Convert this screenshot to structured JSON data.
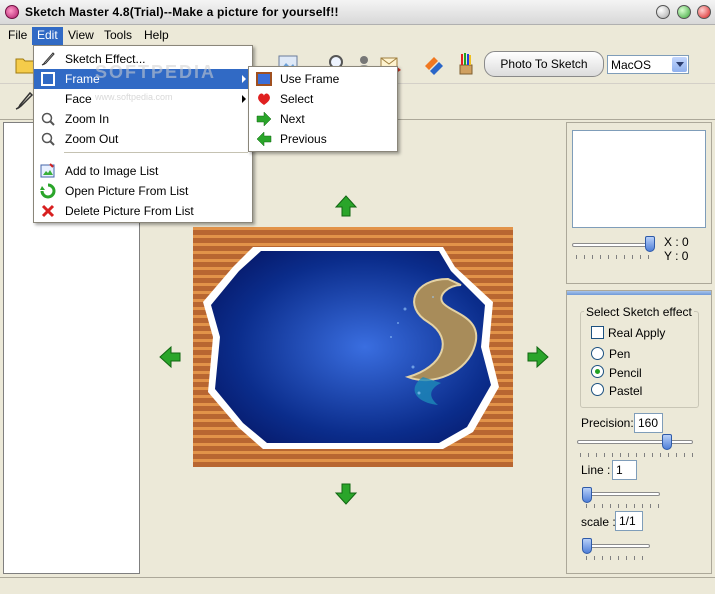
{
  "window": {
    "title": "Sketch Master 4.8(Trial)--Make a picture for yourself!!"
  },
  "menubar": {
    "items": [
      {
        "id": "file",
        "label": "File"
      },
      {
        "id": "edit",
        "label": "Edit"
      },
      {
        "id": "view",
        "label": "View"
      },
      {
        "id": "tools",
        "label": "Tools"
      },
      {
        "id": "help",
        "label": "Help"
      }
    ]
  },
  "edit_menu": {
    "items": [
      {
        "label": "Sketch  Effect...",
        "icon": "sketch-effect-icon"
      },
      {
        "label": "Frame",
        "icon": "frame-icon",
        "has_submenu": true
      },
      {
        "label": "Face",
        "icon": "face-icon",
        "has_submenu": true
      },
      {
        "label": "Zoom In",
        "icon": "zoom-in-icon"
      },
      {
        "label": "Zoom Out",
        "icon": "zoom-out-icon"
      },
      {
        "label": "Add to Image List",
        "icon": "add-image-icon"
      },
      {
        "label": "Open Picture From List",
        "icon": "open-picture-icon"
      },
      {
        "label": "Delete Picture From List",
        "icon": "delete-picture-icon"
      }
    ]
  },
  "frame_submenu": {
    "items": [
      {
        "label": "Use Frame",
        "icon": "use-frame-icon"
      },
      {
        "label": "Select",
        "icon": "select-icon"
      },
      {
        "label": "Next",
        "icon": "next-icon"
      },
      {
        "label": "Previous",
        "icon": "previous-icon"
      }
    ]
  },
  "toolbar": {
    "photo_to_sketch_label": "Photo To Sketch",
    "style_select_value": "MacOS"
  },
  "navigator": {
    "x_label": "X : 0",
    "y_label": "Y : 0"
  },
  "sketch_panel": {
    "group_title": "Select Sketch effect",
    "real_apply_label": "Real Apply",
    "real_apply_checked": false,
    "effects": [
      {
        "label": "Pen",
        "selected": false
      },
      {
        "label": "Pencil",
        "selected": true
      },
      {
        "label": "Pastel",
        "selected": false
      }
    ],
    "precision_label": "Precision:",
    "precision_value": "160",
    "line_label": "Line :",
    "line_value": "1",
    "scale_label": "scale :",
    "scale_value": "1/1"
  },
  "colors": {
    "menu_highlight": "#316ac5",
    "arrow_green": "#2aa52a",
    "picture_blue": "#0b2d8c",
    "frame_brown": "#b25a20"
  },
  "watermark": {
    "text": "SOFTPEDIA",
    "subtext": "www.softpedia.com"
  }
}
